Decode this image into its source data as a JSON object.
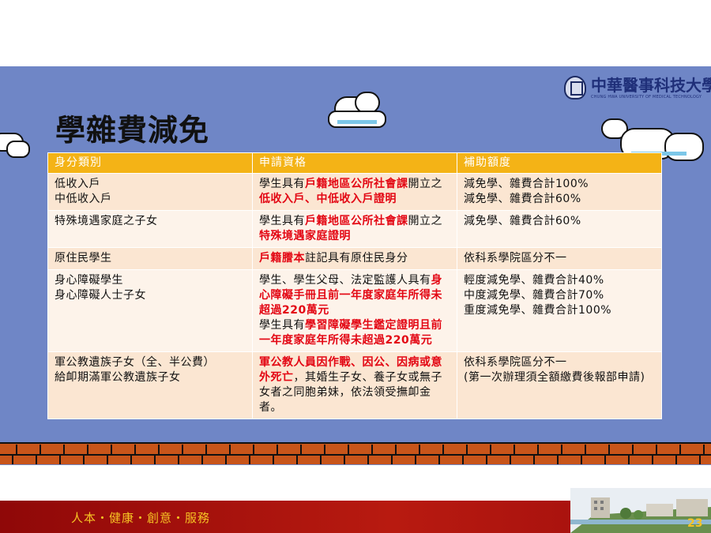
{
  "logo": {
    "name_cn": "中華醫事科技大學",
    "name_en": "CHUNG HWA UNIVERSITY OF MEDICAL TECHNOLOGY"
  },
  "title": "學雜費減免",
  "table": {
    "headers": [
      "身分類別",
      "申請資格",
      "補助額度"
    ],
    "rows": [
      {
        "category": [
          "低收入戶",
          "中低收入戶"
        ],
        "qualification": [
          {
            "text": "學生具有",
            "em": false
          },
          {
            "text": "戶籍地區公所社會課",
            "em": true
          },
          {
            "text": "開立之",
            "em": false
          },
          {
            "text": "低收入戶、中低收入戶證明",
            "em": true
          }
        ],
        "amount": [
          "減免學、雜費合計100%",
          "減免學、雜費合計60%"
        ]
      },
      {
        "category": [
          "特殊境遇家庭之子女"
        ],
        "qualification": [
          {
            "text": "學生具有",
            "em": false
          },
          {
            "text": "戶籍地區公所社會課",
            "em": true
          },
          {
            "text": "開立之",
            "em": false
          },
          {
            "text": "特殊境遇家庭證明",
            "em": true
          }
        ],
        "amount": [
          "減免學、雜費合計60%"
        ]
      },
      {
        "category": [
          "原住民學生"
        ],
        "qualification": [
          {
            "text": "戶籍謄本",
            "em": true
          },
          {
            "text": "註記具有原住民身分",
            "em": false
          }
        ],
        "amount": [
          "依科系學院區分不一"
        ]
      },
      {
        "category": [
          "身心障礙學生",
          "身心障礙人士子女"
        ],
        "qualification": [
          {
            "text": "學生、學生父母、法定監護人具有",
            "em": false
          },
          {
            "text": "身心障礙手冊且前一年度家庭年所得未超過220萬元",
            "em": true
          },
          {
            "text": "學生具有",
            "em": false,
            "newline": true
          },
          {
            "text": "學習障礙學生鑑定證明且前一年度家庭年所得未超過220萬元",
            "em": true
          }
        ],
        "amount": [
          "輕度減免學、雜費合計40%",
          "中度減免學、雜費合計70%",
          "重度減免學、雜費合計100%"
        ]
      },
      {
        "category": [
          "軍公教遺族子女（全、半公費）",
          "給卹期滿軍公教遺族子女"
        ],
        "qualification": [
          {
            "text": "軍公教人員因作戰、因公、因病或意外死亡",
            "em": true
          },
          {
            "text": "，其婚生子女、養子女或無子女者之同胞弟妹，依法領受撫卹金者。",
            "em": false
          }
        ],
        "amount": [
          "依科系學院區分不一",
          "(第一次辦理須全額繳費後報部申請)"
        ]
      }
    ]
  },
  "footer": {
    "motto": "人本・健康・創意・服務",
    "page_number": "23"
  },
  "colors": {
    "band": "#6f86c6",
    "header": "#f4b316",
    "highlight": "#e30613",
    "footer": "#b81a10",
    "motto": "#f6c324"
  }
}
